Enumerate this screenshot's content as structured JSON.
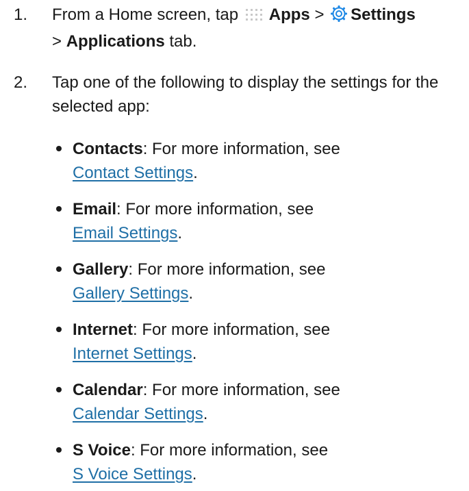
{
  "steps": [
    {
      "number": "1.",
      "text_prefix": "From a Home screen, tap",
      "apps_label": "Apps",
      "separator1": ">",
      "settings_label": "Settings",
      "separator2": ">",
      "tab_label": "Applications",
      "tab_suffix": "tab."
    },
    {
      "number": "2.",
      "text": "Tap one of the following to display the settings for the selected app:"
    }
  ],
  "apps": [
    {
      "name": "Contacts",
      "desc": ": For more information, see",
      "link": "Contact Settings",
      "end": "."
    },
    {
      "name": "Email",
      "desc": ": For more information, see",
      "link": "Email Settings",
      "end": "."
    },
    {
      "name": "Gallery",
      "desc": ": For more information, see",
      "link": "Gallery Settings",
      "end": "."
    },
    {
      "name": "Internet",
      "desc": ": For more information, see",
      "link": "Internet Settings",
      "end": "."
    },
    {
      "name": "Calendar",
      "desc": ": For more information, see",
      "link": "Calendar Settings",
      "end": "."
    },
    {
      "name": "S Voice",
      "desc": ": For more information, see",
      "link": "S Voice Settings",
      "end": "."
    }
  ],
  "icons": {
    "apps": "apps-grid-icon",
    "settings": "settings-gear-icon"
  },
  "colors": {
    "text": "#1a1a1a",
    "link": "#1f6fa6",
    "apps_icon": "#c8c8c8",
    "settings_icon": "#1e88e5"
  }
}
